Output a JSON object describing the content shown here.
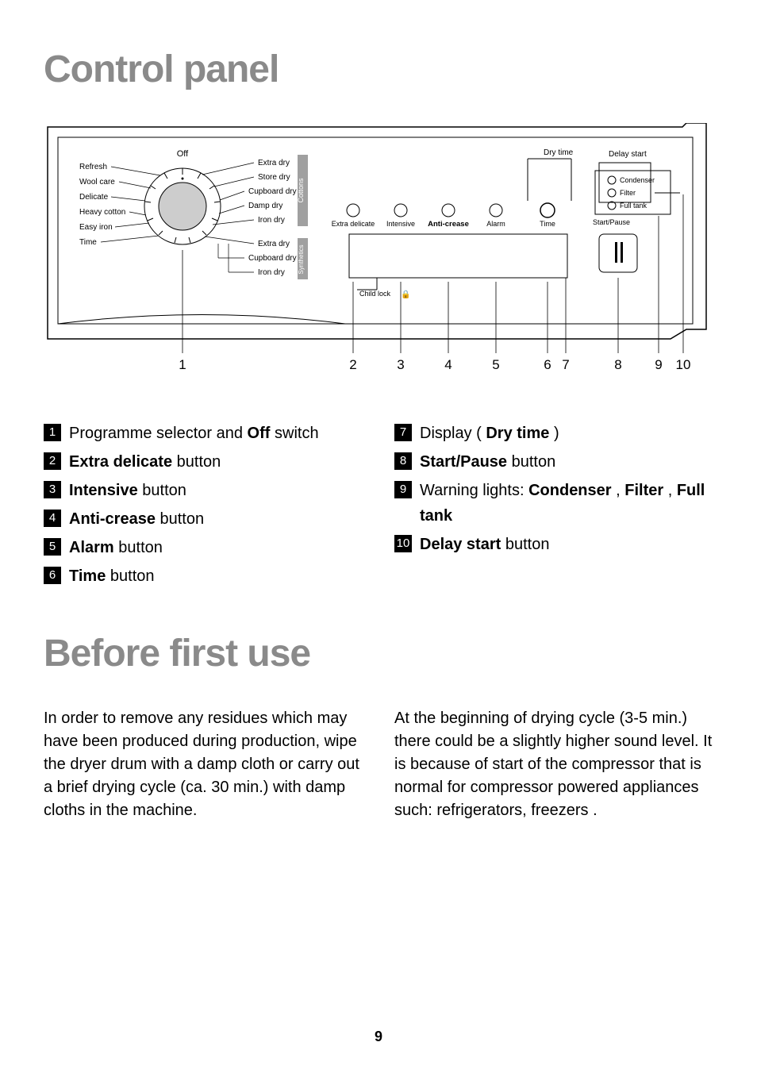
{
  "headings": {
    "h1a": "Control panel",
    "h1b": "Before first use"
  },
  "panel": {
    "dial_top": "Off",
    "dial_left": [
      "Refresh",
      "Wool care",
      "Delicate",
      "Heavy cotton",
      "Easy iron",
      "Time"
    ],
    "dial_right_cottons": [
      "Extra dry",
      "Store dry",
      "Cupboard dry",
      "Damp dry",
      "Iron dry"
    ],
    "dial_right_synth": [
      "Extra dry",
      "Cupboard dry",
      "Iron dry"
    ],
    "group_cottons": "Cottons",
    "group_synth": "Synthetics",
    "buttons_row_top": {
      "dry_time": "Dry time",
      "delay_start": "Delay start"
    },
    "btn_labels": [
      "Extra delicate",
      "Intensive",
      "Anti-crease",
      "Alarm",
      "Time",
      "Start/Pause"
    ],
    "lights": [
      "Condenser",
      "Filter",
      "Full tank"
    ],
    "child_lock": "Child lock",
    "callouts": [
      "1",
      "2",
      "3",
      "4",
      "5",
      "6",
      "7",
      "8",
      "9",
      "10"
    ]
  },
  "legend_left": [
    {
      "n": "1",
      "html": "Programme selector and <b>Off</b> switch"
    },
    {
      "n": "2",
      "html": "<b>Extra delicate</b> button"
    },
    {
      "n": "3",
      "html": "<b>Intensive</b> button"
    },
    {
      "n": "4",
      "html": "<b>Anti-crease</b> button"
    },
    {
      "n": "5",
      "html": "<b>Alarm</b> button"
    },
    {
      "n": "6",
      "html": "<b>Time</b> button"
    }
  ],
  "legend_right": [
    {
      "n": "7",
      "html": "Display ( <b>Dry time</b> )"
    },
    {
      "n": "8",
      "html": "<b>Start/Pause</b> button"
    },
    {
      "n": "9",
      "html": "Warning lights: <b>Condenser</b> , <b>Filter</b> , <b>Full tank</b>"
    },
    {
      "n": "10",
      "html": "<b>Delay start</b> button"
    }
  ],
  "body": {
    "left": "In order to remove any residues which may have been produced during production, wipe the dryer drum with a damp cloth or carry out a brief drying cycle (ca. 30 min.) with damp cloths in the machine.",
    "right": "At the beginning of drying cycle (3-5 min.) there could be a slightly higher sound level. It is because of start of the compressor that is normal for compressor powered appliances such: refrigerators, freezers ."
  },
  "page_number": "9"
}
